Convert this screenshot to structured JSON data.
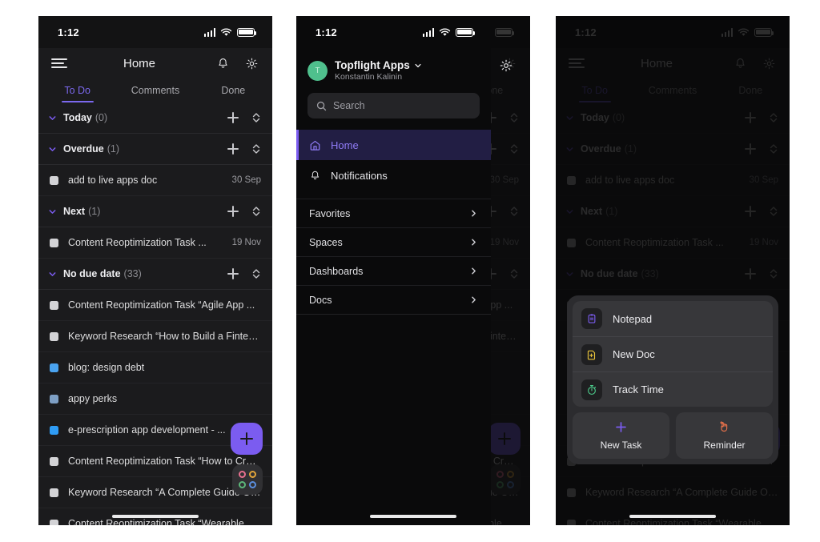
{
  "status_bar": {
    "time": "1:12",
    "cellular_icon": "cellular-signal-icon",
    "wifi_icon": "wifi-icon",
    "battery_icon": "battery-icon"
  },
  "header": {
    "title": "Home",
    "menu_icon": "hamburger-menu-icon",
    "bell_icon": "notification-bell-icon",
    "gear_icon": "settings-gear-icon"
  },
  "tabs": [
    {
      "label": "To Do",
      "active": true
    },
    {
      "label": "Comments",
      "active": false
    },
    {
      "label": "Done",
      "active": false
    }
  ],
  "groups": [
    {
      "label": "Today",
      "count": "(0)",
      "tasks": []
    },
    {
      "label": "Overdue",
      "count": "(1)",
      "tasks": [
        {
          "title": "add to live apps doc",
          "date": "30 Sep",
          "color": "#d3d3d6"
        }
      ]
    },
    {
      "label": "Next",
      "count": "(1)",
      "tasks": [
        {
          "title": "Content Reoptimization Task ...",
          "date": "19 Nov",
          "color": "#d3d3d6"
        }
      ]
    },
    {
      "label": "No due date",
      "count": "(33)",
      "tasks": [
        {
          "title": "Content Reoptimization Task “Agile App ...",
          "date": "",
          "color": "#d3d3d6"
        },
        {
          "title": "Keyword Research  “How to Build a Fintech ...",
          "date": "",
          "color": "#d3d3d6"
        },
        {
          "title": "blog: design debt",
          "date": "",
          "color": "#4aa3f0"
        },
        {
          "title": "appy perks",
          "date": "",
          "color": "#7e9fc4"
        },
        {
          "title": "e-prescription app development - ...",
          "date": "",
          "color": "#2f9cf5"
        },
        {
          "title": "Content Reoptimization Task “How to Crea...",
          "date": "",
          "color": "#d3d3d6"
        },
        {
          "title": "Keyword Research  “A Complete Guide On...",
          "date": "",
          "color": "#d3d3d6"
        },
        {
          "title": "Content Reoptimization Task “Wearable App ...",
          "date": "",
          "color": "#d3d3d6"
        }
      ]
    }
  ],
  "group_actions": {
    "add_icon": "plus-icon",
    "sort_icon": "sort-chevrons-icon",
    "collapse_icon": "chevron-down-icon"
  },
  "fab": {
    "icon": "plus-icon",
    "label": ""
  },
  "widget": {
    "icon": "apps-grid-icon",
    "dots": [
      {
        "name": "dot-pink",
        "color": "#e8708f"
      },
      {
        "name": "dot-orange",
        "color": "#e2a53b"
      },
      {
        "name": "dot-green",
        "color": "#5cb87a"
      },
      {
        "name": "dot-blue",
        "color": "#5b8fe0"
      }
    ]
  },
  "drawer": {
    "account": {
      "avatar_letter": "T",
      "avatar_color": "#4fc08d",
      "workspace": "Topflight Apps",
      "chevron_icon": "chevron-down-icon",
      "user": "Konstantin Kalinin"
    },
    "search": {
      "placeholder": "Search",
      "icon": "search-icon"
    },
    "nav_primary": [
      {
        "label": "Home",
        "icon": "home-icon",
        "active": true
      },
      {
        "label": "Notifications",
        "icon": "bell-icon",
        "active": false
      }
    ],
    "nav_sections": [
      {
        "label": "Favorites",
        "chevron": "chevron-right-icon"
      },
      {
        "label": "Spaces",
        "chevron": "chevron-right-icon"
      },
      {
        "label": "Dashboards",
        "chevron": "chevron-right-icon"
      },
      {
        "label": "Docs",
        "chevron": "chevron-right-icon"
      }
    ],
    "settings_icon": "settings-gear-icon"
  },
  "action_sheet": {
    "items": [
      {
        "label": "Notepad",
        "icon": "notepad-icon",
        "color": "#7b5cf0"
      },
      {
        "label": "New Doc",
        "icon": "new-doc-icon",
        "color": "#e8c23a"
      },
      {
        "label": "Track Time",
        "icon": "stopwatch-icon",
        "color": "#4cc98a"
      }
    ],
    "buttons": [
      {
        "label": "New Task",
        "icon": "plus-icon",
        "color": "#7b5cf0"
      },
      {
        "label": "Reminder",
        "icon": "reminder-hand-icon",
        "color": "#e8714a"
      }
    ]
  },
  "colors": {
    "accent": "#7b5cf0",
    "tab_active": "#7b68ee",
    "panel_bg": "#1b1b1d",
    "drawer_bg": "#0a0a0b"
  }
}
